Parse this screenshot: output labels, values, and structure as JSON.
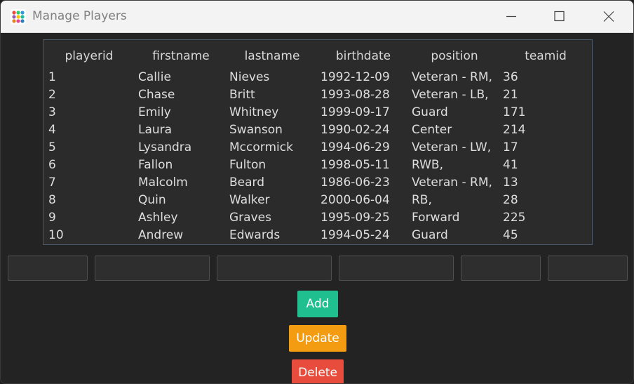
{
  "window": {
    "title": "Manage Players"
  },
  "table": {
    "columns": [
      "playerid",
      "firstname",
      "lastname",
      "birthdate",
      "position",
      "teamid"
    ],
    "rows": [
      [
        "1",
        "Callie",
        "Nieves",
        "1992-12-09",
        "Veteran - RM,",
        "36"
      ],
      [
        "2",
        "Chase",
        "Britt",
        "1993-08-28",
        "Veteran - LB,",
        "21"
      ],
      [
        "3",
        "Emily",
        "Whitney",
        "1999-09-17",
        "Guard",
        "171"
      ],
      [
        "4",
        "Laura",
        "Swanson",
        "1990-02-24",
        "Center",
        "214"
      ],
      [
        "5",
        "Lysandra",
        "Mccormick",
        "1994-06-29",
        "Veteran - LW,",
        "17"
      ],
      [
        "6",
        "Fallon",
        "Fulton",
        "1998-05-11",
        "RWB,",
        "41"
      ],
      [
        "7",
        "Malcolm",
        "Beard",
        "1986-06-23",
        "Veteran - RM,",
        "13"
      ],
      [
        "8",
        "Quin",
        "Walker",
        "2000-06-04",
        "RB,",
        "28"
      ],
      [
        "9",
        "Ashley",
        "Graves",
        "1995-09-25",
        "Forward",
        "225"
      ],
      [
        "10",
        "Andrew",
        "Edwards",
        "1994-05-24",
        "Guard",
        "45"
      ]
    ]
  },
  "inputs": [
    {
      "name": "playerid-input",
      "value": ""
    },
    {
      "name": "firstname-input",
      "value": ""
    },
    {
      "name": "lastname-input",
      "value": ""
    },
    {
      "name": "birthdate-input",
      "value": ""
    },
    {
      "name": "position-input",
      "value": ""
    },
    {
      "name": "teamid-input",
      "value": ""
    }
  ],
  "buttons": {
    "add": "Add",
    "update": "Update",
    "delete": "Delete"
  },
  "colors": {
    "add": "#1fbf8f",
    "update": "#f39c12",
    "delete": "#e74c3c"
  },
  "icons": {
    "app": "app-dots-icon",
    "minimize": "minimize-icon",
    "maximize": "maximize-icon",
    "close": "close-icon"
  }
}
